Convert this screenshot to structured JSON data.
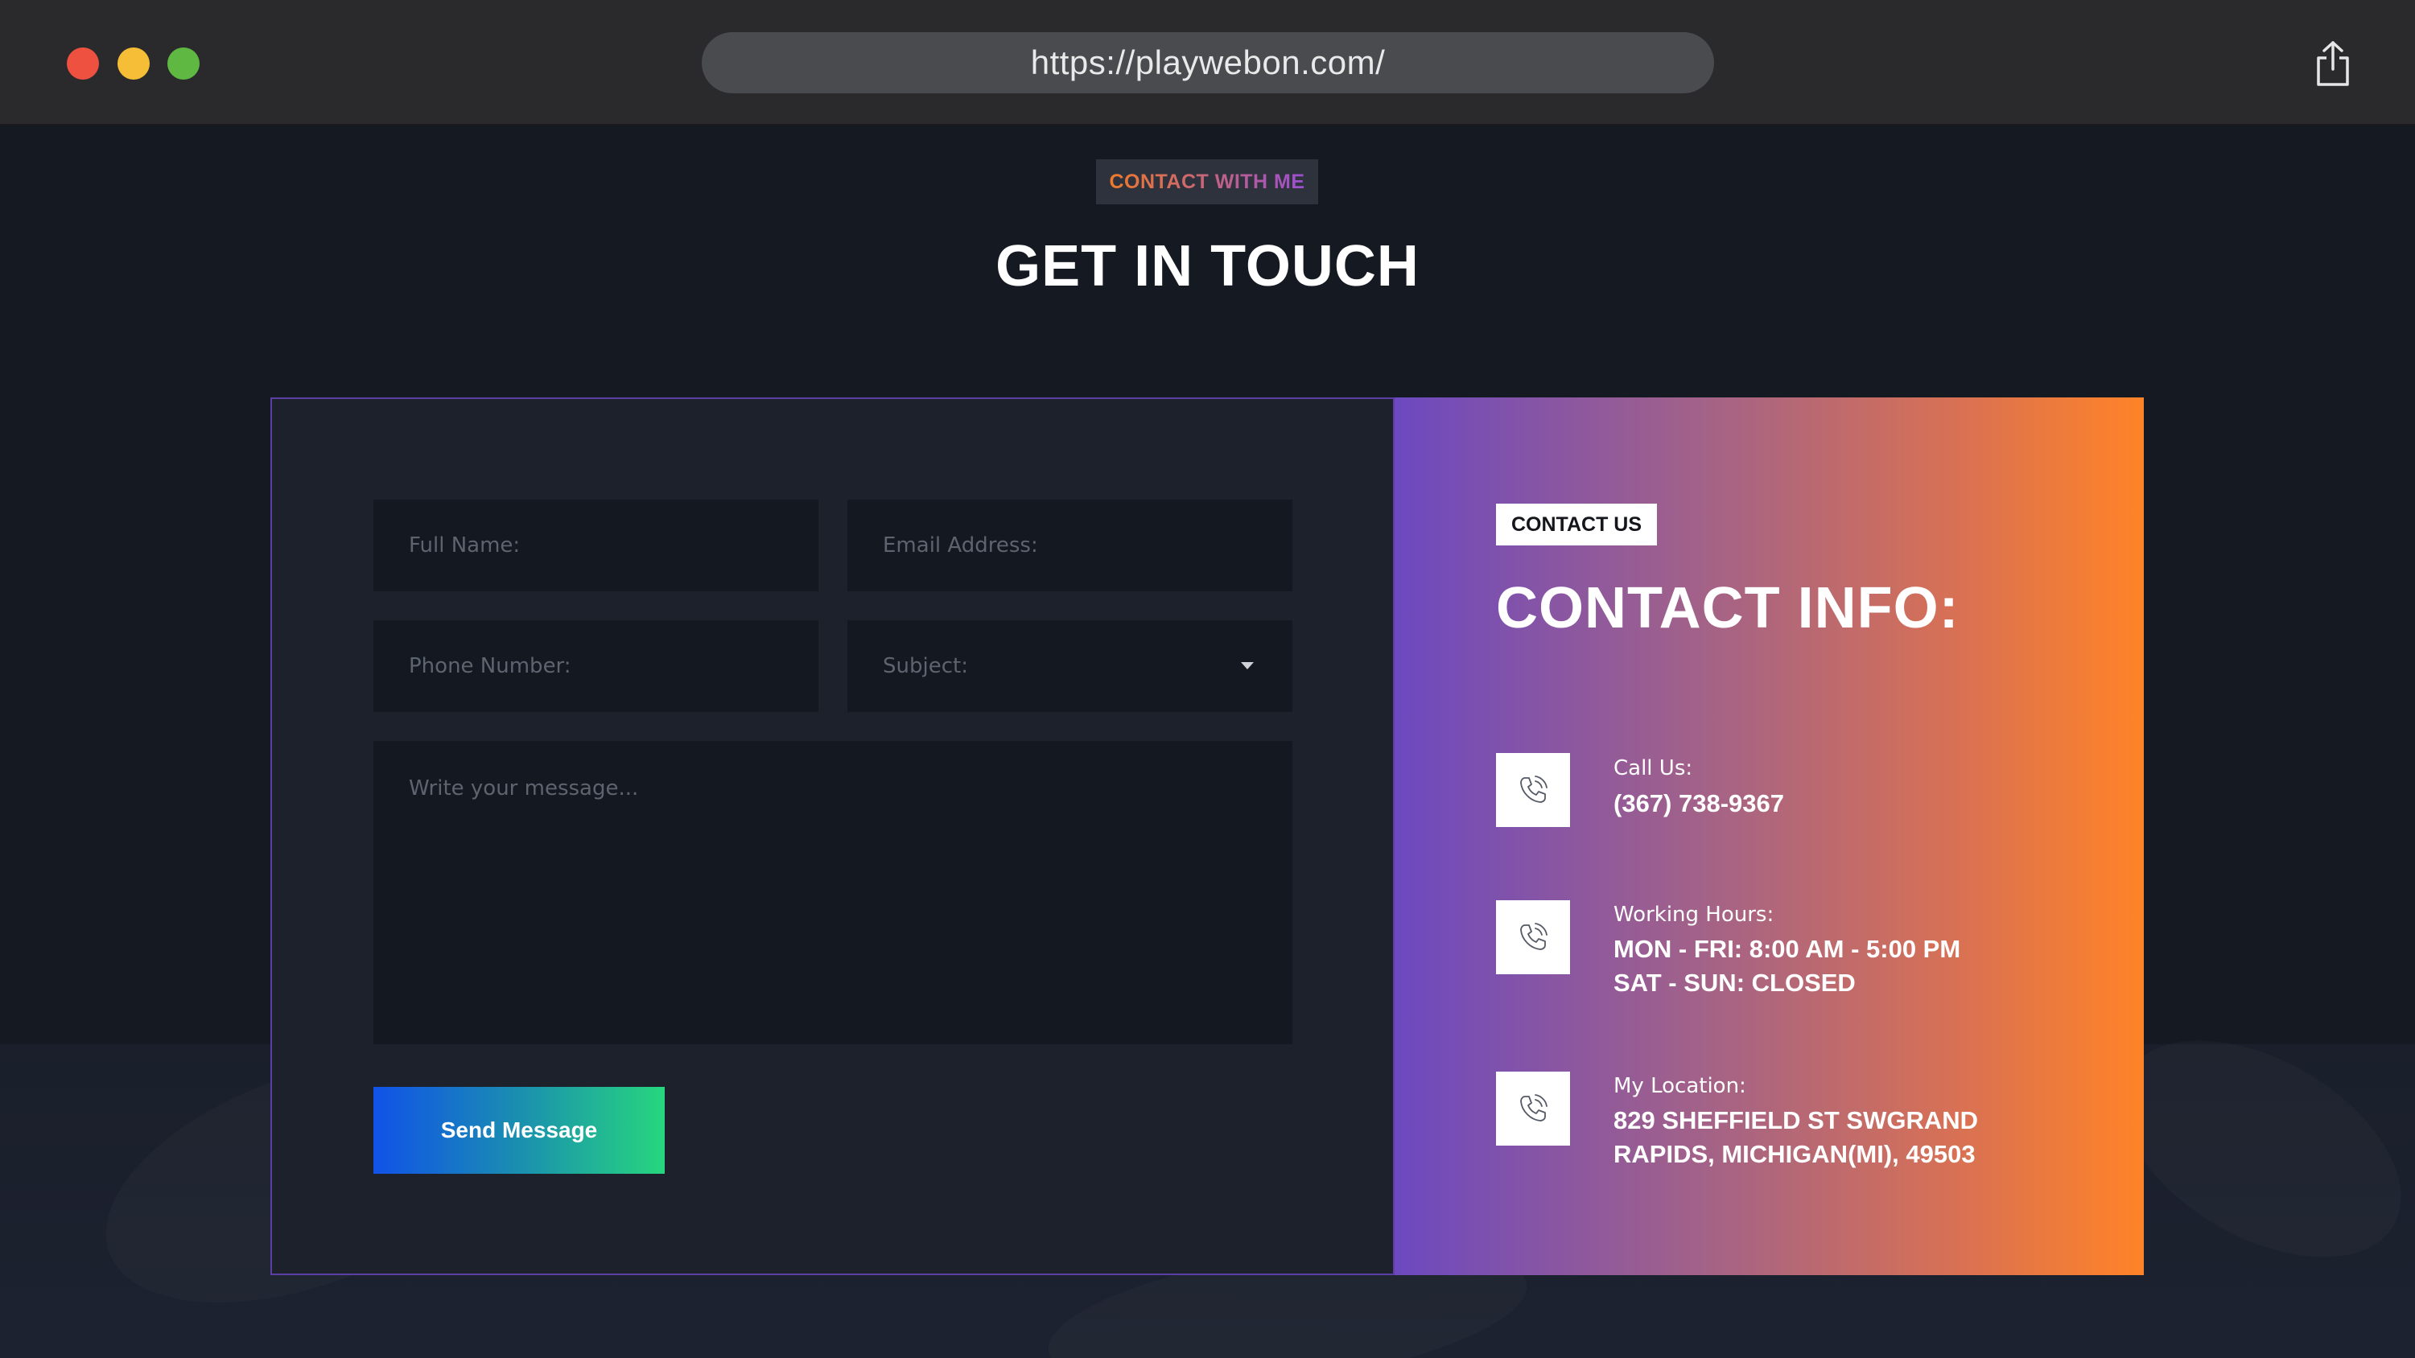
{
  "browser": {
    "url": "https://playwebon.com/"
  },
  "section": {
    "eyebrow": "CONTACT WITH ME",
    "title": "GET IN TOUCH"
  },
  "form": {
    "full_name_placeholder": "Full Name:",
    "email_placeholder": "Email Address:",
    "phone_placeholder": "Phone Number:",
    "subject_placeholder": "Subject:",
    "message_placeholder": "Write your message...",
    "send_label": "Send Message"
  },
  "contact": {
    "tag": "CONTACT US",
    "title": "CONTACT INFO:",
    "items": [
      {
        "label": "Call Us:",
        "lines": [
          "(367) 738-9367"
        ],
        "icon": "phone-icon"
      },
      {
        "label": "Working Hours:",
        "lines": [
          "MON - FRI: 8:00 AM - 5:00 PM",
          "SAT - SUN: CLOSED"
        ],
        "icon": "phone-icon"
      },
      {
        "label": "My Location:",
        "lines": [
          "829 SHEFFIELD ST SWGRAND",
          "RAPIDS, MICHIGAN(MI), 49503"
        ],
        "icon": "phone-icon"
      }
    ]
  },
  "colors": {
    "page_bg": "#151922",
    "card_bg": "#1d212c",
    "accent_orange": "#ff8327",
    "accent_purple": "#6c49c0",
    "button_blue": "#1152e8",
    "button_green": "#27d67d"
  }
}
